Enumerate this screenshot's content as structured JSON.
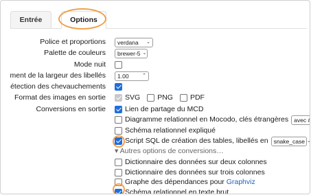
{
  "tabs": {
    "entree": "Entrée",
    "options": "Options"
  },
  "labels": {
    "font": "Police et proportions",
    "palette": "Palette de couleurs",
    "night": "Mode nuit",
    "label_width": "ment de la largeur des libellés",
    "overlap": "étection des chevauchements",
    "image_formats": "Format des images en sortie",
    "conversions": "Conversions en sortie"
  },
  "controls": {
    "font_value": "verdana",
    "palette_value": "brewer-5",
    "width_value": "1.00",
    "svg": "SVG",
    "png": "PNG",
    "pdf": "PDF",
    "relation_value": "avec #",
    "case_value": "snake_case"
  },
  "conversions": {
    "share_link": "Lien de partage du MCD",
    "mocodo_diagram": "Diagramme relationnel en Mocodo, clés étrangères",
    "explained_schema": "Schéma relationnel expliqué",
    "sql_script": "Script SQL de création des tables, libellés en",
    "more_toggle": "▾ Autres options de conversions…",
    "dict_two": "Dictionnaire des données sur deux colonnes",
    "dict_three": "Dictionnaire des données sur trois colonnes",
    "graph_prefix": "Graphe des dépendances pour ",
    "graph_link": "Graphviz",
    "raw_schema": "Schéma relationnel en texte brut"
  },
  "colors": {
    "accent": "#1f6fdb",
    "highlight": "#f0a04b",
    "link": "#1f5fbf"
  },
  "state": {
    "night_mode": false,
    "overlap_detection": true,
    "svg": true,
    "png": false,
    "pdf": false,
    "share_link": true,
    "mocodo_diagram": false,
    "explained_schema": false,
    "sql_script": true,
    "dict_two": false,
    "dict_three": false,
    "graph": false,
    "raw_schema": true
  }
}
